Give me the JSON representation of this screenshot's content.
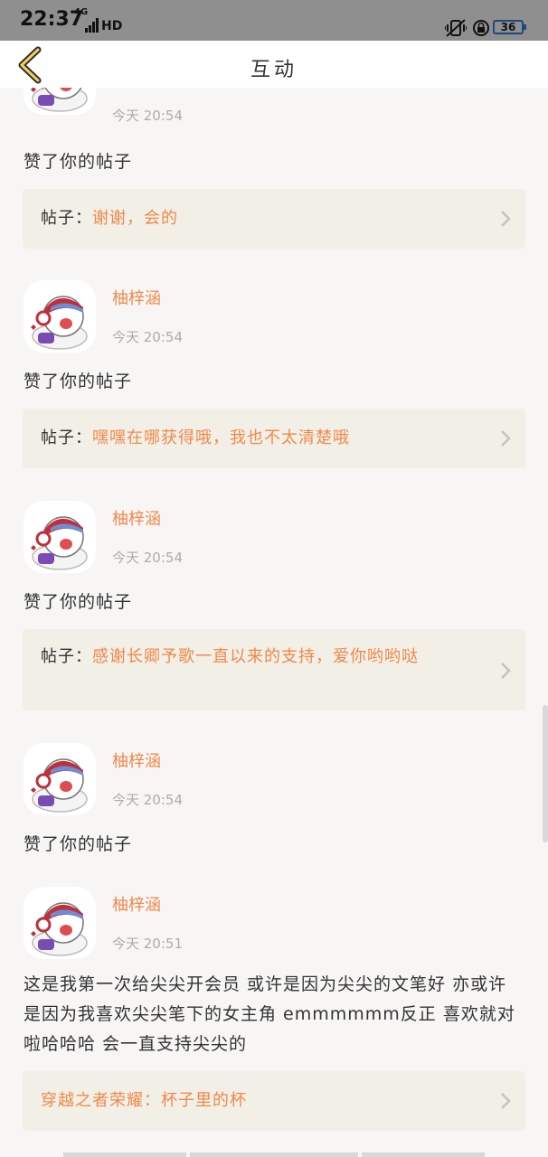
{
  "status_bar": {
    "time": "22:37",
    "network": "4G",
    "hd": "HD",
    "battery": "36"
  },
  "nav": {
    "title": "互动"
  },
  "colors": {
    "accent": "#f0894a",
    "card_bg": "#f1efe6",
    "background": "#f7f6f5"
  },
  "items": [
    {
      "username": "",
      "time": "今天 20:54",
      "action": "赞了你的帖子",
      "card": {
        "label": "帖子：",
        "text": "谢谢，会的"
      }
    },
    {
      "username": "柚梓涵",
      "time": "今天 20:54",
      "action": "赞了你的帖子",
      "card": {
        "label": "帖子：",
        "text": "嘿嘿在哪获得哦，我也不太清楚哦"
      }
    },
    {
      "username": "柚梓涵",
      "time": "今天 20:54",
      "action": "赞了你的帖子",
      "card": {
        "label": "帖子：",
        "text": "感谢长卿予歌一直以来的支持，爱你哟哟哒"
      }
    },
    {
      "username": "柚梓涵",
      "time": "今天 20:54",
      "action": "赞了你的帖子"
    },
    {
      "username": "柚梓涵",
      "time": "今天 20:51",
      "comment": "这是我第一次给尖尖开会员 或许是因为尖尖的文笔好 亦或许是因为我喜欢尖尖笔下的女主角 emmmmmm反正 喜欢就对啦哈哈哈 会一直支持尖尖的",
      "card": {
        "label": "穿越之者荣耀：",
        "text": "杯子里的杯"
      }
    }
  ]
}
